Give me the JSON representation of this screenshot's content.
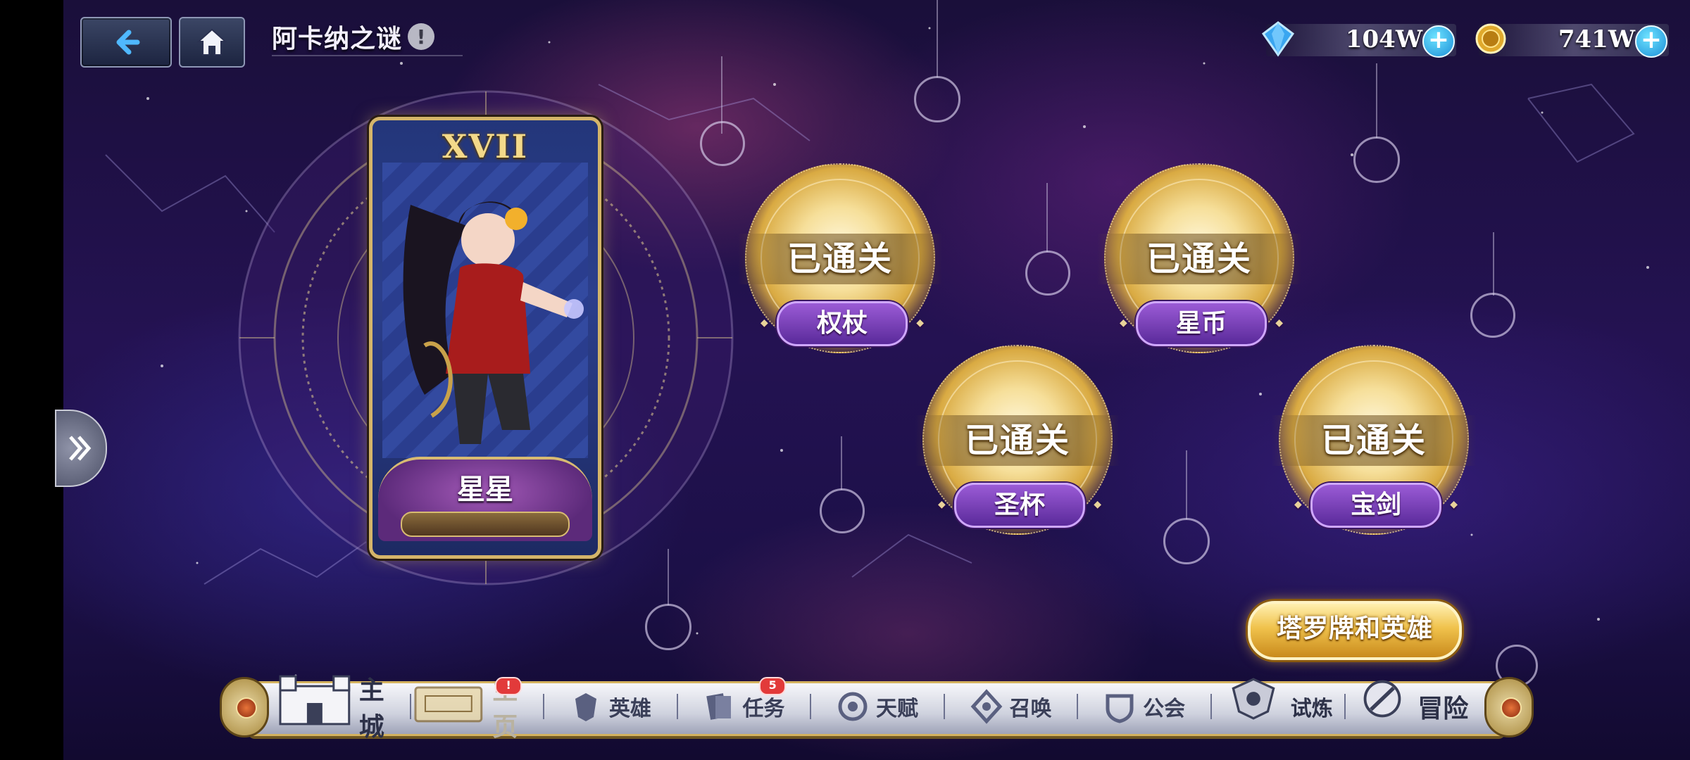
{
  "header": {
    "title": "阿卡纳之谜",
    "info_icon": "!"
  },
  "currency": [
    {
      "icon": "diamond-icon",
      "value": "104W"
    },
    {
      "icon": "gold-coin-icon",
      "value": "741W"
    }
  ],
  "card": {
    "numeral": "XVII",
    "name": "星星"
  },
  "stages": [
    {
      "status": "已通关",
      "name": "权杖"
    },
    {
      "status": "已通关",
      "name": "星币"
    },
    {
      "status": "已通关",
      "name": "圣杯"
    },
    {
      "status": "已通关",
      "name": "宝剑"
    }
  ],
  "tarot_button": "塔罗牌和英雄",
  "nav": {
    "items": [
      {
        "label": "主城",
        "icon": "castle-icon"
      },
      {
        "label": "主页",
        "icon": "homepage-icon",
        "badge": "!"
      },
      {
        "label": "英雄",
        "icon": "hero-icon"
      },
      {
        "label": "任务",
        "icon": "quest-icon",
        "badge": "5"
      },
      {
        "label": "天赋",
        "icon": "talent-icon"
      },
      {
        "label": "召唤",
        "icon": "summon-icon"
      },
      {
        "label": "公会",
        "icon": "guild-icon"
      },
      {
        "label": "试炼",
        "icon": "trial-icon"
      },
      {
        "label": "冒险",
        "icon": "adventure-icon"
      }
    ]
  },
  "colors": {
    "gold": "#d4b56a",
    "purple_label": "#7a3fbf",
    "badge_red": "#e23a3a",
    "plus_blue": "#1b8fd8"
  }
}
